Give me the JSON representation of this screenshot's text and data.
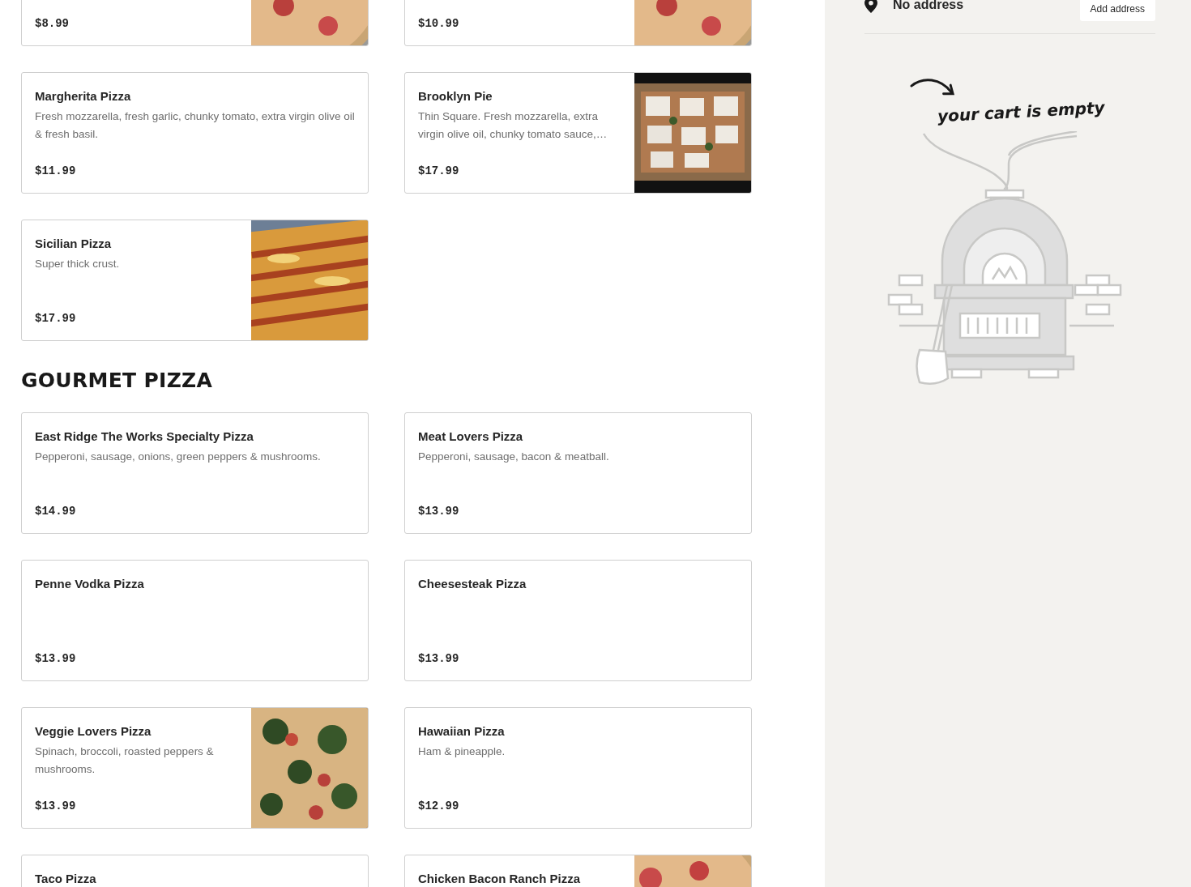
{
  "menu": {
    "sections": [
      {
        "items": [
          {
            "price": "$8.99",
            "photo": true
          },
          {
            "price": "$10.99",
            "photo": true
          },
          {
            "name": "Margherita Pizza",
            "description": "Fresh mozzarella, fresh garlic, chunky tomato, extra virgin olive oil & fresh basil.",
            "price": "$11.99",
            "photo": false
          },
          {
            "name": "Brooklyn Pie",
            "description": "Thin Square. Fresh mozzarella, extra virgin olive oil, chunky tomato sauce,…",
            "price": "$17.99",
            "photo": true
          },
          {
            "name": "Sicilian Pizza",
            "description": "Super thick crust.",
            "price": "$17.99",
            "photo": true
          }
        ]
      },
      {
        "title": "GOURMET PIZZA",
        "items": [
          {
            "name": "East Ridge The Works Specialty Pizza",
            "description": "Pepperoni, sausage, onions, green peppers & mushrooms.",
            "price": "$14.99",
            "photo": false
          },
          {
            "name": "Meat Lovers Pizza",
            "description": "Pepperoni, sausage, bacon & meatball.",
            "price": "$13.99",
            "photo": false
          },
          {
            "name": "Penne Vodka Pizza",
            "price": "$13.99",
            "photo": false
          },
          {
            "name": "Cheesesteak Pizza",
            "price": "$13.99",
            "photo": false
          },
          {
            "name": "Veggie Lovers Pizza",
            "description": "Spinach, broccoli, roasted peppers & mushrooms.",
            "price": "$13.99",
            "photo": true
          },
          {
            "name": "Hawaiian Pizza",
            "description": "Ham & pineapple.",
            "price": "$12.99",
            "photo": false
          },
          {
            "name": "Taco Pizza",
            "photo": false
          },
          {
            "name": "Chicken Bacon Ranch Pizza",
            "photo": true
          }
        ]
      }
    ]
  },
  "cart": {
    "address": "No address",
    "add_button": "Add address",
    "empty_message": "your cart is empty"
  }
}
